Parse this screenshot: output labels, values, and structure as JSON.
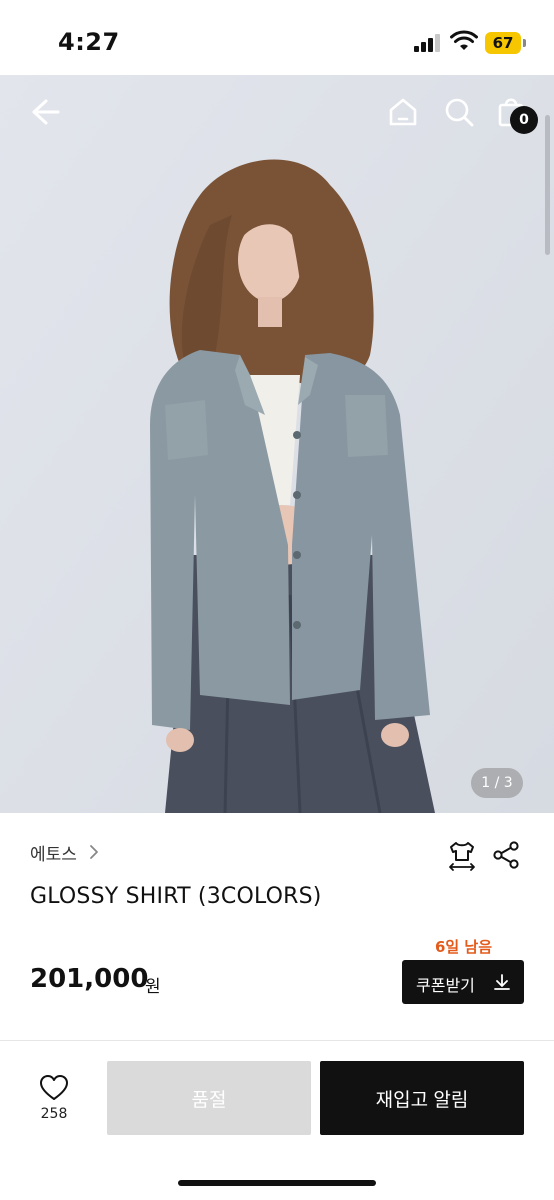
{
  "status": {
    "time": "4:27",
    "battery": "67"
  },
  "gallery": {
    "counter": "1 / 3",
    "cart_count": "0"
  },
  "product": {
    "brand": "에토스",
    "name": "GLOSSY SHIRT (3COLORS)",
    "remaining": "6일 남음",
    "price": "201,000",
    "currency": "원"
  },
  "actions": {
    "coupon": "쿠폰받기",
    "like_count": "258",
    "sold_out": "품절",
    "restock_alert": "재입고 알림"
  },
  "icons": [
    "back-arrow-icon",
    "home-icon",
    "search-icon",
    "shopping-bag-icon",
    "chevron-right-icon",
    "size-guide-icon",
    "share-icon",
    "download-icon",
    "heart-icon"
  ],
  "colors": {
    "accent": "#e35b1b",
    "dark": "#111111",
    "disabled": "#dadada",
    "battery": "#f6c600"
  }
}
